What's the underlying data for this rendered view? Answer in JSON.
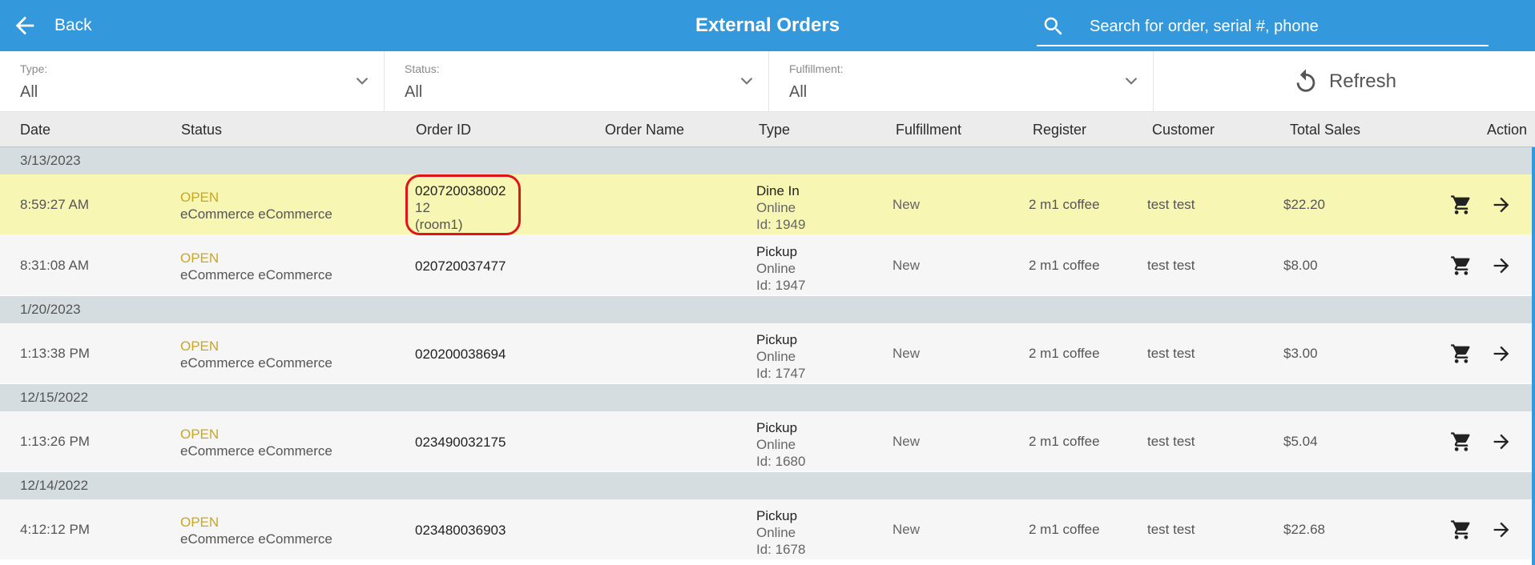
{
  "header": {
    "back_label": "Back",
    "title": "External Orders",
    "search_placeholder": "Search for order, serial #, phone",
    "icons": {
      "back": "arrow-left-icon",
      "search": "search-icon"
    },
    "background_color": "#3398dc"
  },
  "filters": {
    "type": {
      "label": "Type:",
      "value": "All"
    },
    "status": {
      "label": "Status:",
      "value": "All"
    },
    "fulfillment": {
      "label": "Fulfillment:",
      "value": "All"
    },
    "refresh_label": "Refresh"
  },
  "columns": {
    "date": "Date",
    "status": "Status",
    "order_id": "Order ID",
    "order_name": "Order Name",
    "type": "Type",
    "fulfillment": "Fulfillment",
    "register": "Register",
    "customer": "Customer",
    "total_sales": "Total Sales",
    "action": "Action"
  },
  "groups": [
    {
      "date": "3/13/2023",
      "orders": [
        {
          "time": "8:59:27 AM",
          "status": "OPEN",
          "status_sub": "eCommerce eCommerce",
          "order_id": "020720038002",
          "order_id_sub1": "12",
          "order_id_sub2": "(room1)",
          "type_main": "Dine In",
          "type_channel": "Online",
          "type_id": "Id: 1949",
          "fulfillment": "New",
          "register": "2  m1 coffee",
          "customer": "test test",
          "total": "$22.20"
        },
        {
          "time": "8:31:08 AM",
          "status": "OPEN",
          "status_sub": "eCommerce eCommerce",
          "order_id": "020720037477",
          "type_main": "Pickup",
          "type_channel": "Online",
          "type_id": "Id: 1947",
          "fulfillment": "New",
          "register": "2  m1 coffee",
          "customer": "test test",
          "total": "$8.00"
        }
      ]
    },
    {
      "date": "1/20/2023",
      "orders": [
        {
          "time": "1:13:38 PM",
          "status": "OPEN",
          "status_sub": "eCommerce eCommerce",
          "order_id": "020200038694",
          "type_main": "Pickup",
          "type_channel": "Online",
          "type_id": "Id: 1747",
          "fulfillment": "New",
          "register": "2  m1 coffee",
          "customer": "test test",
          "total": "$3.00"
        }
      ]
    },
    {
      "date": "12/15/2022",
      "orders": [
        {
          "time": "1:13:26 PM",
          "status": "OPEN",
          "status_sub": "eCommerce eCommerce",
          "order_id": "023490032175",
          "type_main": "Pickup",
          "type_channel": "Online",
          "type_id": "Id: 1680",
          "fulfillment": "New",
          "register": "2  m1 coffee",
          "customer": "test test",
          "total": "$5.04"
        }
      ]
    },
    {
      "date": "12/14/2022",
      "orders": [
        {
          "time": "4:12:12 PM",
          "status": "OPEN",
          "status_sub": "eCommerce eCommerce",
          "order_id": "023480036903",
          "type_main": "Pickup",
          "type_channel": "Online",
          "type_id": "Id: 1678",
          "fulfillment": "New",
          "register": "2  m1 coffee",
          "customer": "test test",
          "total": "$22.68"
        }
      ]
    }
  ],
  "row_icons": {
    "cart": "shopping-cart-icon",
    "open": "arrow-right-icon"
  },
  "colors": {
    "highlight_row": "#f7f6b2",
    "status_open": "#c8a626",
    "annotation_circle": "#e0141a"
  }
}
